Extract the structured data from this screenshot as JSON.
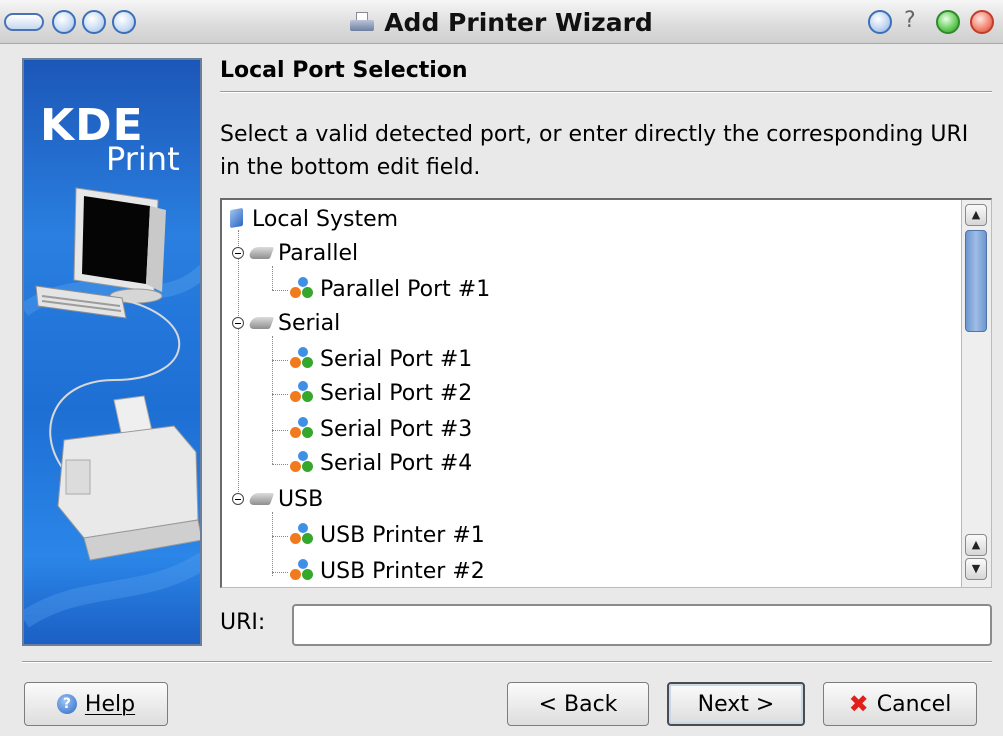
{
  "window": {
    "title": "Add Printer Wizard"
  },
  "banner": {
    "brand": "KDE",
    "product": "Print"
  },
  "page": {
    "title": "Local Port Selection",
    "intro": "Select a valid detected port, or enter directly the corresponding URI in the bottom edit field."
  },
  "tree": {
    "root": "Local System",
    "groups": [
      {
        "label": "Parallel",
        "items": [
          "Parallel Port #1"
        ]
      },
      {
        "label": "Serial",
        "items": [
          "Serial Port #1",
          "Serial Port #2",
          "Serial Port #3",
          "Serial Port #4"
        ]
      },
      {
        "label": "USB",
        "items": [
          "USB Printer #1",
          "USB Printer #2"
        ]
      }
    ]
  },
  "uri": {
    "label": "URI:",
    "value": ""
  },
  "buttons": {
    "help": "Help",
    "back": "< Back",
    "next": "Next >",
    "cancel": "Cancel"
  }
}
